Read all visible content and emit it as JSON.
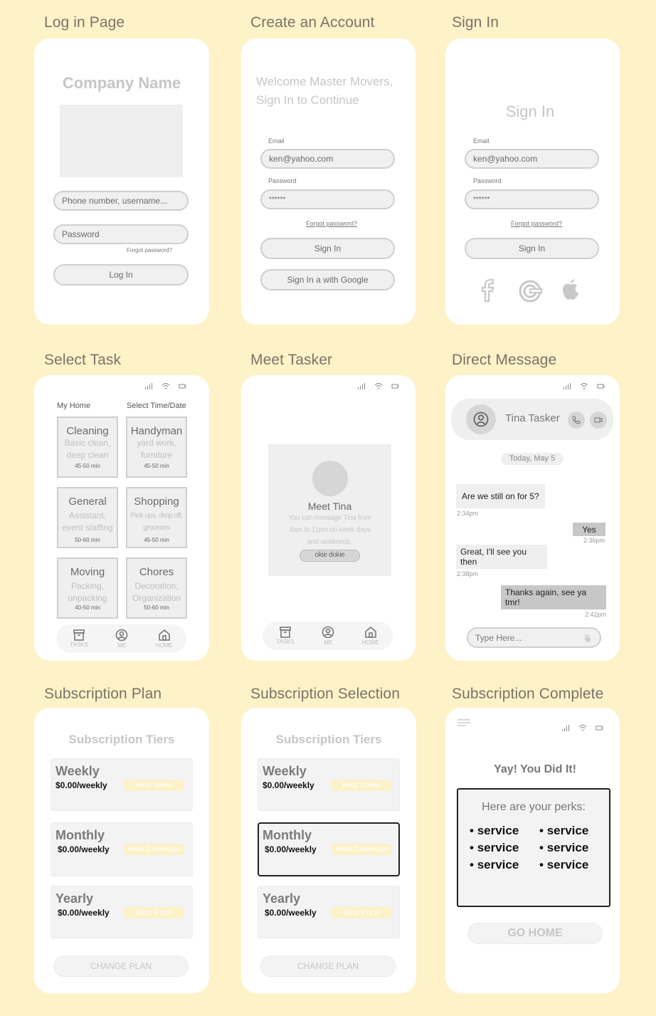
{
  "screens": {
    "login": {
      "label": "Log in Page",
      "company": "Company Name",
      "username_placeholder": "Phone number, username...",
      "password_placeholder": "Password",
      "forgot": "Forgot password?",
      "login_button": "Log In"
    },
    "create": {
      "label": "Create an Account",
      "welcome_line1": "Welcome Master Movers,",
      "welcome_line2": "Sign In to Continue",
      "email_label": "Email",
      "email_value": "ken@yahoo.com",
      "password_label": "Password",
      "password_value": "******",
      "forgot": "Forgot password?",
      "signin_button": "Sign In",
      "google_button": "Sign In a with Google"
    },
    "signin": {
      "label": "Sign In",
      "title": "Sign In",
      "email_label": "Email",
      "email_value": "ken@yahoo.com",
      "password_label": "Password",
      "password_value": "******",
      "forgot": "Forgot password?",
      "signin_button": "Sign In",
      "social": [
        "facebook-icon",
        "google-icon",
        "apple-icon"
      ]
    },
    "select_task": {
      "label": "Select Task",
      "my_home": "My Home",
      "select_time": "Select Time/Date",
      "cards": [
        {
          "title": "Cleaning",
          "desc1": "Basic clean,",
          "desc2": "deep clean",
          "time": "45-50 min"
        },
        {
          "title": "Handyman",
          "desc1": "yard work,",
          "desc2": "furniture",
          "time": "45-50 min"
        },
        {
          "title": "General",
          "desc1": "Assistant,",
          "desc2": "event staffing",
          "time": "50-60 min"
        },
        {
          "title": "Shopping",
          "desc1": "Pick-ups, drop off,",
          "desc2": "groceries",
          "time": "45-50 min"
        },
        {
          "title": "Moving",
          "desc1": "Packing,",
          "desc2": "unpacking",
          "time": "40-50 min"
        },
        {
          "title": "Chores",
          "desc1": "Decoration,",
          "desc2": "Organization",
          "time": "50-60 min"
        }
      ],
      "nav": [
        {
          "label": "TASKS",
          "icon": "archive-icon"
        },
        {
          "label": "ME",
          "icon": "user-circle-icon"
        },
        {
          "label": "HOME",
          "icon": "home-icon"
        }
      ]
    },
    "meet_tasker": {
      "label": "Meet Tasker",
      "title": "Meet Tina",
      "desc1": "You can message Tina  from",
      "desc2": "4am to 11pm on week days",
      "desc3": "and weekends.",
      "button": "okie dokie",
      "nav": [
        {
          "label": "TASKS",
          "icon": "archive-icon"
        },
        {
          "label": "ME",
          "icon": "user-circle-icon"
        },
        {
          "label": "HOME",
          "icon": "home-icon"
        }
      ]
    },
    "direct_message": {
      "label": "Direct Message",
      "contact": "Tina Tasker",
      "date": "Today, May 5",
      "messages": [
        {
          "text": "Are we still on for 5?",
          "time": "2:34pm",
          "dir": "in"
        },
        {
          "text": "Yes",
          "time": "2:36pm",
          "dir": "out"
        },
        {
          "text": "Great, I'll see you then",
          "time": "2:38pm",
          "dir": "in"
        },
        {
          "text": "Thanks again, see ya tmr!",
          "time": "2:42pm",
          "dir": "out"
        }
      ],
      "input_placeholder": "Type Here..."
    },
    "sub_plan": {
      "label": "Subscription Plan",
      "title": "Subscription Tiers",
      "tiers": [
        {
          "name": "Weekly",
          "price": "$0.00/weekly",
          "badge": "Best Value"
        },
        {
          "name": "Monthly",
          "price": "$0.00/weekly",
          "badge": "Best Coverage"
        },
        {
          "name": "Yearly",
          "price": "$0.00/weekly",
          "badge": "Best Price"
        }
      ],
      "button": "CHANGE PLAN"
    },
    "sub_select": {
      "label": "Subscription Selection",
      "title": "Subscription Tiers",
      "selected": "Monthly",
      "tiers": [
        {
          "name": "Weekly",
          "price": "$0.00/weekly",
          "badge": "Best Value"
        },
        {
          "name": "Monthly",
          "price": "$0.00/weekly",
          "badge": "Best Coverage"
        },
        {
          "name": "Yearly",
          "price": "$0.00/weekly",
          "badge": "Best Price"
        }
      ],
      "button": "CHANGE PLAN"
    },
    "sub_complete": {
      "label": "Subscription Complete",
      "title": "Yay! You Did It!",
      "perks_title": "Here are your perks:",
      "perks": [
        "service",
        "service",
        "service",
        "service",
        "service",
        "service"
      ],
      "button": "GO HOME"
    }
  },
  "colors": {
    "background": "#fef2c8",
    "phone": "#ffffff",
    "field": "#f0f0f0",
    "badge": "#fdf1c8"
  }
}
